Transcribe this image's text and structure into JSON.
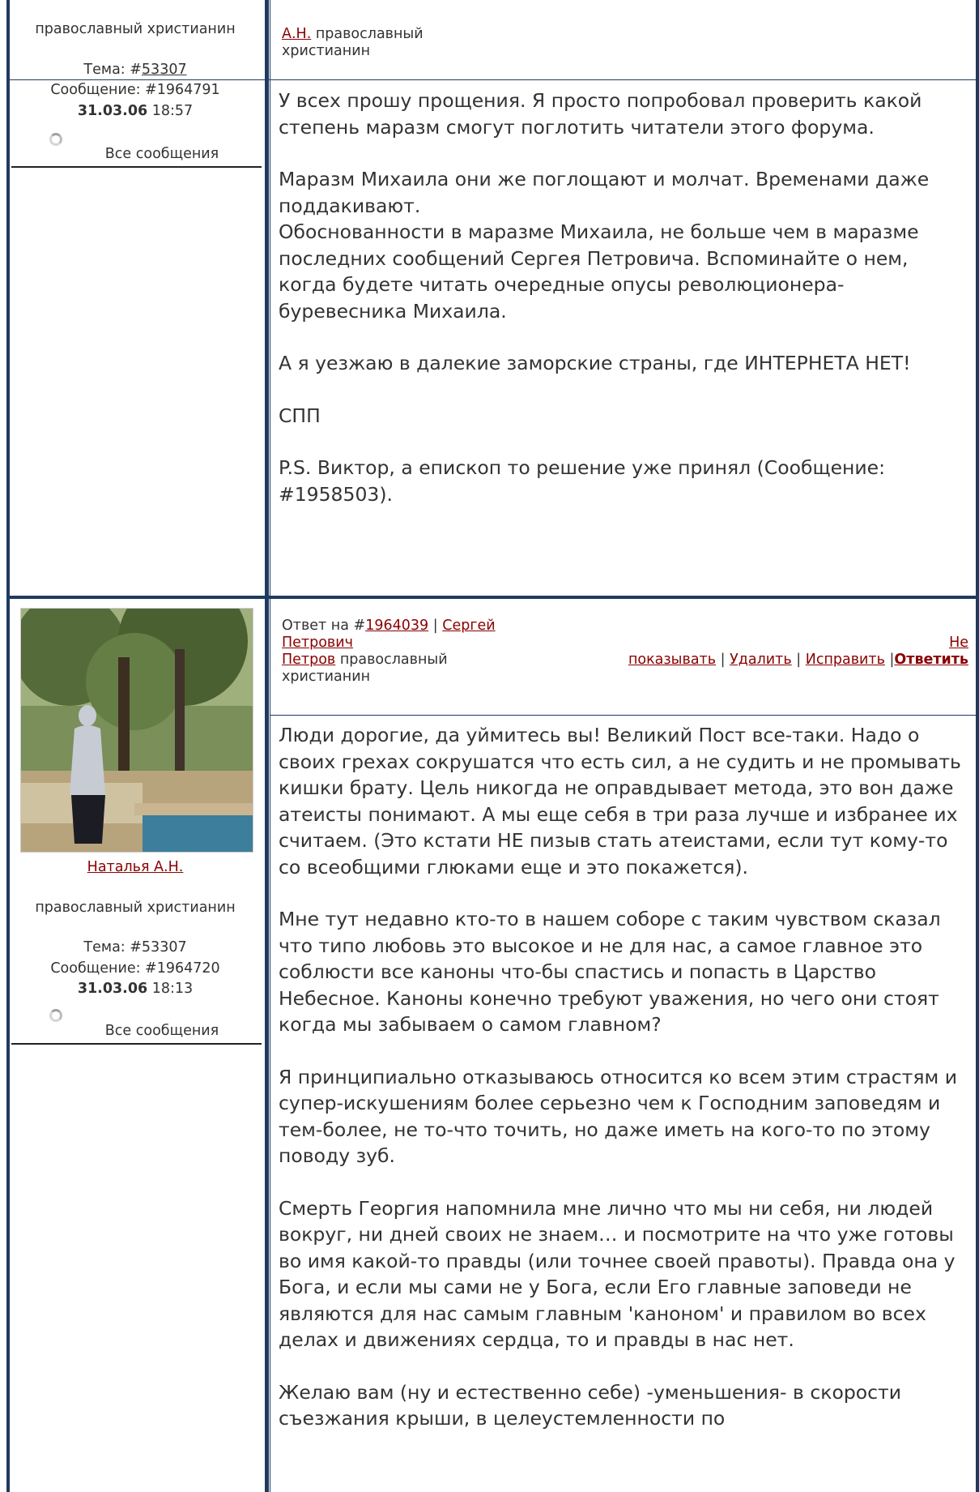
{
  "post1": {
    "author_status": "православный христианин",
    "topic_label": "Тема: #",
    "topic_id": "53307",
    "message_label": "Сообщение: #",
    "message_id": "1964791",
    "date": "31.03.06",
    "time": "18:57",
    "all_messages": "Все сообщения",
    "header_author_link": "А.Н.",
    "header_status_line1": "православный",
    "header_status_line2": "христианин",
    "paragraphs": [
      "У всех прошу прощения. Я просто попробовал проверить какой степень маразм смогут поглотить читатели этого форума.",
      "Маразм Михаила они же поглощают и молчат. Временами даже поддакивают.\nОбоснованности в маразме Михаила, не больше чем в маразме последних сообщений Сергея Петровича. Вспоминайте о нем, когда будете читать очередные опусы революционера-буревесника Михаила.",
      "А я уезжаю в далекие заморские страны, где ИНТЕРНЕТА НЕТ!",
      "СПП",
      "P.S. Виктор, а епископ то решение уже принял (Сообщение: #1958503)."
    ]
  },
  "post2": {
    "author_name": "Наталья А.Н.",
    "author_status": "православный христианин",
    "topic_label": "Тема: #",
    "topic_id": "53307",
    "message_label": "Сообщение: #",
    "message_id": "1964720",
    "date": "31.03.06",
    "time": "18:13",
    "all_messages": "Все сообщения",
    "reply_prefix": "Ответ на #",
    "reply_id": "1964039",
    "separator": "|",
    "reply_author_line1": "Сергей",
    "reply_author_line2": "Петрович",
    "reply_author_line3": "Петров",
    "reply_status_line1": "православный",
    "reply_status_line2": "христианин",
    "action_hide_line1": "Не",
    "action_hide_line2": "показывать",
    "action_delete": "Удалить",
    "action_edit": "Исправить",
    "action_reply": "Ответить",
    "paragraphs": [
      "Люди дорогие, да уймитесь вы! Великий Пост все-таки. Надо о своих грехах сокрушатся что есть сил, а не судить и не промывать кишки брату. Цель никогда не оправдывает метода, это вон даже атеисты понимают. А мы еще себя в три раза лучше и избранее их считаем. (Это кстати НЕ пизыв стать атеистами, если тут кому-то со всеобщими глюками еще и это покажется).",
      "Мне тут недавно кто-то в нашем соборе с таким чувством сказал что типо любовь это высокое и не для нас, а самое главное это соблюсти все каноны что-бы спастись и попасть в Царство Небесное. Каноны конечно требуют уважения, но чего они стоят когда мы забываем о самом главном?",
      "Я принципиально отказываюсь относится ко всем этим страстям и супер-искушениям более серьезно чем к Господним заповедям и тем-более, не то-что точить, но даже иметь на кого-то по этому поводу зуб.",
      "Смерть Георгия напомнила мне лично что мы ни себя, ни людей вокруг, ни дней своих не знаем… и посмотрите на что уже готовы во имя какой-то правды (или точнее своей правоты). Правда она у Бога, и если мы сами не у Бога, если Его главные заповеди не являются для нас самым главным 'каноном' и правилом во всех делах и движениях сердца, то и правды в нас нет.",
      "Желаю вам (ну и естественно себе) -уменьшения- в скорости съезжания крыши, в целеустемленности по"
    ]
  },
  "colors": {
    "frame": "#1f3a60",
    "link": "#8b0000",
    "text": "#333333"
  }
}
